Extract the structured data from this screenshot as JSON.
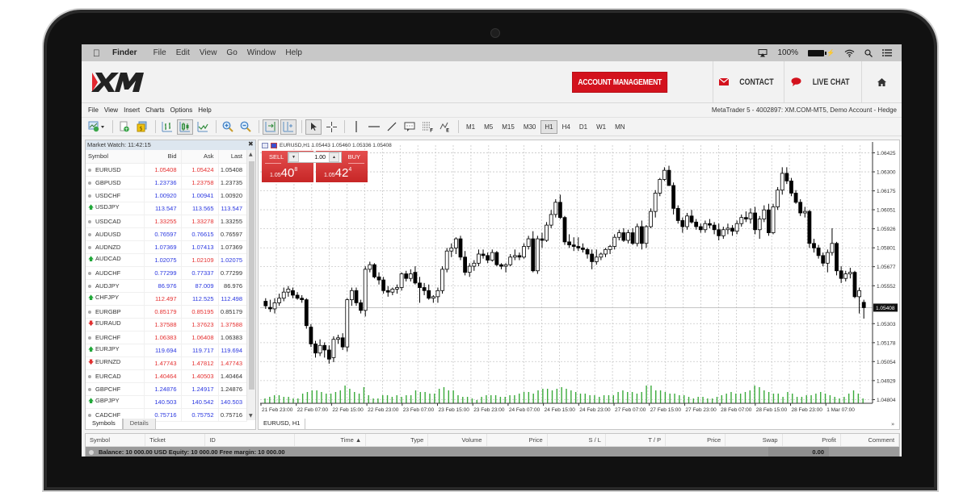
{
  "mac_menubar": {
    "apple_icon": "apple-logo-icon",
    "app": "Finder",
    "items": [
      "File",
      "Edit",
      "View",
      "Go",
      "Window",
      "Help"
    ],
    "status": {
      "airplay_icon": "airplay-icon",
      "battery_percent": "100%",
      "battery_icon": "battery-charging-icon",
      "wifi_icon": "wifi-icon",
      "search_icon": "spotlight-search-icon",
      "list_icon": "notification-list-icon"
    }
  },
  "header": {
    "logo": "XM",
    "account_management": "ACCOUNT MANAGEMENT",
    "contact": "CONTACT",
    "live_chat": "LIVE CHAT",
    "home_icon": "home-icon",
    "accent_color": "#d3121d"
  },
  "mt_menu": {
    "items": [
      "File",
      "View",
      "Insert",
      "Charts",
      "Options",
      "Help"
    ],
    "window_title": "MetaTrader 5 - 4002897: XM.COM-MT5, Demo Account - Hedge"
  },
  "toolbar": {
    "timeframes": [
      "M1",
      "M5",
      "M15",
      "M30",
      "H1",
      "H4",
      "D1",
      "W1",
      "MN"
    ],
    "active_timeframe": "H1"
  },
  "market_watch": {
    "title": "Market Watch: 11:42:15",
    "columns": [
      "Symbol",
      "Bid",
      "Ask",
      "Last"
    ],
    "rows": [
      {
        "symbol": "EURUSD",
        "indicator": "neutral",
        "bid": "1.05408",
        "bid_c": "red",
        "ask": "1.05424",
        "ask_c": "red",
        "last": "1.05408",
        "last_c": "blk"
      },
      {
        "symbol": "GBPUSD",
        "indicator": "neutral",
        "bid": "1.23736",
        "bid_c": "blue",
        "ask": "1.23758",
        "ask_c": "red",
        "last": "1.23735",
        "last_c": "blk"
      },
      {
        "symbol": "USDCHF",
        "indicator": "neutral",
        "bid": "1.00920",
        "bid_c": "blue",
        "ask": "1.00941",
        "ask_c": "blue",
        "last": "1.00920",
        "last_c": "blk"
      },
      {
        "symbol": "USDJPY",
        "indicator": "up",
        "bid": "113.547",
        "bid_c": "blue",
        "ask": "113.565",
        "ask_c": "blue",
        "last": "113.547",
        "last_c": "blue"
      },
      {
        "symbol": "USDCAD",
        "indicator": "neutral",
        "bid": "1.33255",
        "bid_c": "red",
        "ask": "1.33278",
        "ask_c": "red",
        "last": "1.33255",
        "last_c": "blk"
      },
      {
        "symbol": "AUDUSD",
        "indicator": "neutral",
        "bid": "0.76597",
        "bid_c": "blue",
        "ask": "0.76615",
        "ask_c": "blue",
        "last": "0.76597",
        "last_c": "blk"
      },
      {
        "symbol": "AUDNZD",
        "indicator": "neutral",
        "bid": "1.07369",
        "bid_c": "blue",
        "ask": "1.07413",
        "ask_c": "blue",
        "last": "1.07369",
        "last_c": "blk"
      },
      {
        "symbol": "AUDCAD",
        "indicator": "up",
        "bid": "1.02075",
        "bid_c": "blue",
        "ask": "1.02109",
        "ask_c": "red",
        "last": "1.02075",
        "last_c": "blue"
      },
      {
        "symbol": "AUDCHF",
        "indicator": "neutral",
        "bid": "0.77299",
        "bid_c": "blue",
        "ask": "0.77337",
        "ask_c": "blue",
        "last": "0.77299",
        "last_c": "blk"
      },
      {
        "symbol": "AUDJPY",
        "indicator": "neutral",
        "bid": "86.976",
        "bid_c": "blue",
        "ask": "87.009",
        "ask_c": "blue",
        "last": "86.976",
        "last_c": "blk"
      },
      {
        "symbol": "CHFJPY",
        "indicator": "up",
        "bid": "112.497",
        "bid_c": "red",
        "ask": "112.525",
        "ask_c": "blue",
        "last": "112.498",
        "last_c": "blue"
      },
      {
        "symbol": "EURGBP",
        "indicator": "neutral",
        "bid": "0.85179",
        "bid_c": "red",
        "ask": "0.85195",
        "ask_c": "red",
        "last": "0.85179",
        "last_c": "blk"
      },
      {
        "symbol": "EURAUD",
        "indicator": "down",
        "bid": "1.37588",
        "bid_c": "red",
        "ask": "1.37623",
        "ask_c": "red",
        "last": "1.37588",
        "last_c": "red"
      },
      {
        "symbol": "EURCHF",
        "indicator": "neutral",
        "bid": "1.06383",
        "bid_c": "red",
        "ask": "1.06408",
        "ask_c": "red",
        "last": "1.06383",
        "last_c": "blk"
      },
      {
        "symbol": "EURJPY",
        "indicator": "up",
        "bid": "119.694",
        "bid_c": "blue",
        "ask": "119.717",
        "ask_c": "blue",
        "last": "119.694",
        "last_c": "blue"
      },
      {
        "symbol": "EURNZD",
        "indicator": "down",
        "bid": "1.47743",
        "bid_c": "red",
        "ask": "1.47812",
        "ask_c": "red",
        "last": "1.47743",
        "last_c": "red"
      },
      {
        "symbol": "EURCAD",
        "indicator": "neutral",
        "bid": "1.40464",
        "bid_c": "red",
        "ask": "1.40503",
        "ask_c": "red",
        "last": "1.40464",
        "last_c": "blk"
      },
      {
        "symbol": "GBPCHF",
        "indicator": "neutral",
        "bid": "1.24876",
        "bid_c": "blue",
        "ask": "1.24917",
        "ask_c": "blue",
        "last": "1.24876",
        "last_c": "blk"
      },
      {
        "symbol": "GBPJPY",
        "indicator": "up",
        "bid": "140.503",
        "bid_c": "blue",
        "ask": "140.542",
        "ask_c": "blue",
        "last": "140.503",
        "last_c": "blue"
      },
      {
        "symbol": "CADCHF",
        "indicator": "neutral",
        "bid": "0.75716",
        "bid_c": "blue",
        "ask": "0.75752",
        "ask_c": "blue",
        "last": "0.75716",
        "last_c": "blk"
      }
    ],
    "tabs": [
      "Symbols",
      "Details"
    ],
    "active_tab": "Symbols",
    "colors": {
      "up": "#2a37e0",
      "down": "#e53030"
    }
  },
  "chart": {
    "header": "EURUSD,H1  1.05443 1.05460 1.05336 1.05408",
    "sell_label": "SELL",
    "buy_label": "BUY",
    "volume": "1.00",
    "sell_price": {
      "prefix": "1.05",
      "big": "40",
      "sup": "8"
    },
    "buy_price": {
      "prefix": "1.05",
      "big": "42",
      "sup": "4"
    },
    "tab": "EURUSD, H1",
    "price_labels": [
      "1.06425",
      "1.06300",
      "1.06175",
      "1.06051",
      "1.05926",
      "1.05801",
      "1.05677",
      "1.05552",
      "1.05303",
      "1.05178",
      "1.05054",
      "1.04929",
      "1.04804"
    ],
    "current_price": "1.05408",
    "time_labels": [
      "21 Feb 23:00",
      "22 Feb 07:00",
      "22 Feb 15:00",
      "22 Feb 23:00",
      "23 Feb 07:00",
      "23 Feb 15:00",
      "23 Feb 23:00",
      "24 Feb 07:00",
      "24 Feb 15:00",
      "24 Feb 23:00",
      "27 Feb 07:00",
      "27 Feb 15:00",
      "27 Feb 23:00",
      "28 Feb 07:00",
      "28 Feb 15:00",
      "28 Feb 23:00",
      "1 Mar 07:00"
    ],
    "candles": [
      [
        1.0545,
        1.0547,
        1.054,
        1.0542
      ],
      [
        1.0541,
        1.0546,
        1.0538,
        1.054
      ],
      [
        1.054,
        1.0547,
        1.0537,
        1.0544
      ],
      [
        1.0544,
        1.055,
        1.0542,
        1.0547
      ],
      [
        1.0547,
        1.0554,
        1.0545,
        1.0551
      ],
      [
        1.0551,
        1.0555,
        1.0548,
        1.0553
      ],
      [
        1.0552,
        1.0554,
        1.0547,
        1.0549
      ],
      [
        1.0549,
        1.0551,
        1.0546,
        1.0547
      ],
      [
        1.0547,
        1.0549,
        1.0544,
        1.0546
      ],
      [
        1.0546,
        1.0547,
        1.0527,
        1.0529
      ],
      [
        1.0528,
        1.053,
        1.0515,
        1.0517
      ],
      [
        1.0517,
        1.0519,
        1.0508,
        1.0511
      ],
      [
        1.0511,
        1.052,
        1.0509,
        1.0516
      ],
      [
        1.0516,
        1.0518,
        1.0508,
        1.0513
      ],
      [
        1.0513,
        1.0516,
        1.0504,
        1.0507
      ],
      [
        1.0508,
        1.0522,
        1.0505,
        1.052
      ],
      [
        1.052,
        1.0523,
        1.0517,
        1.0521
      ],
      [
        1.0521,
        1.0524,
        1.0513,
        1.0515
      ],
      [
        1.0515,
        1.0547,
        1.0512,
        1.0546
      ],
      [
        1.0546,
        1.0554,
        1.0542,
        1.0552
      ],
      [
        1.0552,
        1.0554,
        1.0542,
        1.0544
      ],
      [
        1.0544,
        1.0546,
        1.0537,
        1.0539
      ],
      [
        1.0539,
        1.0568,
        1.0535,
        1.0566
      ],
      [
        1.0566,
        1.0571,
        1.0564,
        1.0569
      ],
      [
        1.0569,
        1.057,
        1.056,
        1.0561
      ],
      [
        1.0561,
        1.0564,
        1.0556,
        1.0559
      ],
      [
        1.0559,
        1.0561,
        1.055,
        1.0552
      ],
      [
        1.0552,
        1.0555,
        1.0548,
        1.0551
      ],
      [
        1.0551,
        1.0554,
        1.0549,
        1.0553
      ],
      [
        1.0553,
        1.0556,
        1.055,
        1.0554
      ],
      [
        1.0554,
        1.0564,
        1.0552,
        1.0563
      ],
      [
        1.0563,
        1.0565,
        1.0558,
        1.056
      ],
      [
        1.056,
        1.0566,
        1.0558,
        1.0563
      ],
      [
        1.0564,
        1.0568,
        1.0556,
        1.0557
      ],
      [
        1.0557,
        1.0561,
        1.0544,
        1.0554
      ],
      [
        1.0554,
        1.0557,
        1.0549,
        1.0552
      ],
      [
        1.0552,
        1.0556,
        1.0546,
        1.0547
      ],
      [
        1.0547,
        1.0549,
        1.0544,
        1.0548
      ],
      [
        1.0548,
        1.0554,
        1.0544,
        1.0552
      ],
      [
        1.0552,
        1.0568,
        1.055,
        1.0566
      ],
      [
        1.0566,
        1.058,
        1.0564,
        1.0578
      ],
      [
        1.0578,
        1.0583,
        1.0574,
        1.058
      ],
      [
        1.058,
        1.0587,
        1.0576,
        1.0586
      ],
      [
        1.0586,
        1.0588,
        1.0572,
        1.0574
      ],
      [
        1.0574,
        1.0578,
        1.0562,
        1.0564
      ],
      [
        1.0564,
        1.057,
        1.0561,
        1.0568
      ],
      [
        1.0568,
        1.0572,
        1.0565,
        1.057
      ],
      [
        1.057,
        1.0579,
        1.0568,
        1.0576
      ],
      [
        1.0576,
        1.0579,
        1.0573,
        1.0575
      ],
      [
        1.0575,
        1.0577,
        1.057,
        1.0572
      ],
      [
        1.0572,
        1.0579,
        1.0571,
        1.0577
      ],
      [
        1.0577,
        1.0578,
        1.0568,
        1.0569
      ],
      [
        1.0569,
        1.057,
        1.0566,
        1.0568
      ],
      [
        1.0568,
        1.057,
        1.0564,
        1.0569
      ],
      [
        1.0569,
        1.0576,
        1.0568,
        1.0574
      ],
      [
        1.0574,
        1.0579,
        1.0572,
        1.0575
      ],
      [
        1.0575,
        1.0577,
        1.0572,
        1.0574
      ],
      [
        1.0574,
        1.0583,
        1.0573,
        1.0581
      ],
      [
        1.0581,
        1.0588,
        1.0579,
        1.0586
      ],
      [
        1.0586,
        1.0591,
        1.0564,
        1.0565
      ],
      [
        1.0565,
        1.0588,
        1.0563,
        1.0586
      ],
      [
        1.0586,
        1.059,
        1.058,
        1.0585
      ],
      [
        1.0585,
        1.0597,
        1.0584,
        1.0595
      ],
      [
        1.0595,
        1.0605,
        1.0593,
        1.0602
      ],
      [
        1.0602,
        1.0612,
        1.06,
        1.061
      ],
      [
        1.061,
        1.0615,
        1.0599,
        1.06
      ],
      [
        1.06,
        1.0601,
        1.0582,
        1.0584
      ],
      [
        1.0584,
        1.0589,
        1.058,
        1.0582
      ],
      [
        1.0582,
        1.0587,
        1.0578,
        1.0581
      ],
      [
        1.0581,
        1.0587,
        1.0578,
        1.058
      ],
      [
        1.058,
        1.0583,
        1.0577,
        1.0579
      ],
      [
        1.0579,
        1.058,
        1.0573,
        1.0576
      ],
      [
        1.0576,
        1.0579,
        1.0566,
        1.0571
      ],
      [
        1.0571,
        1.0579,
        1.0569,
        1.0574
      ],
      [
        1.0574,
        1.0577,
        1.0572,
        1.0576
      ],
      [
        1.0576,
        1.058,
        1.0574,
        1.0579
      ],
      [
        1.0579,
        1.0582,
        1.0576,
        1.0581
      ],
      [
        1.0581,
        1.0589,
        1.0579,
        1.0587
      ],
      [
        1.0587,
        1.0592,
        1.0585,
        1.059
      ],
      [
        1.059,
        1.0593,
        1.0584,
        1.0585
      ],
      [
        1.0585,
        1.0592,
        1.0583,
        1.059
      ],
      [
        1.059,
        1.0593,
        1.0582,
        1.0583
      ],
      [
        1.0583,
        1.0596,
        1.0581,
        1.0594
      ],
      [
        1.0594,
        1.0598,
        1.0579,
        1.0583
      ],
      [
        1.0583,
        1.0595,
        1.058,
        1.0594
      ],
      [
        1.0594,
        1.0606,
        1.0593,
        1.0604
      ],
      [
        1.0604,
        1.0618,
        1.06,
        1.0616
      ],
      [
        1.0616,
        1.0626,
        1.0614,
        1.0625
      ],
      [
        1.0625,
        1.0633,
        1.0624,
        1.0631
      ],
      [
        1.0631,
        1.0634,
        1.0621,
        1.0621
      ],
      [
        1.0621,
        1.0623,
        1.0602,
        1.0606
      ],
      [
        1.0606,
        1.0608,
        1.0596,
        1.0598
      ],
      [
        1.0598,
        1.06,
        1.059,
        1.0594
      ],
      [
        1.0594,
        1.0603,
        1.0592,
        1.0601
      ],
      [
        1.0601,
        1.0605,
        1.0596,
        1.0597
      ],
      [
        1.0597,
        1.0599,
        1.0592,
        1.0594
      ],
      [
        1.0594,
        1.0596,
        1.059,
        1.0592
      ],
      [
        1.0592,
        1.0598,
        1.059,
        1.0596
      ],
      [
        1.0596,
        1.0599,
        1.0593,
        1.0595
      ],
      [
        1.0595,
        1.0597,
        1.0589,
        1.0592
      ],
      [
        1.0592,
        1.0596,
        1.0585,
        1.0588
      ],
      [
        1.0588,
        1.0594,
        1.0586,
        1.0592
      ],
      [
        1.0592,
        1.0596,
        1.0589,
        1.0593
      ],
      [
        1.0593,
        1.0595,
        1.0588,
        1.0591
      ],
      [
        1.0591,
        1.0598,
        1.0589,
        1.0596
      ],
      [
        1.0596,
        1.0602,
        1.0594,
        1.06
      ],
      [
        1.06,
        1.0604,
        1.0597,
        1.0599
      ],
      [
        1.0599,
        1.0606,
        1.0596,
        1.0603
      ],
      [
        1.0603,
        1.0607,
        1.0589,
        1.0592
      ],
      [
        1.0592,
        1.0601,
        1.0586,
        1.0599
      ],
      [
        1.0599,
        1.0608,
        1.0597,
        1.0605
      ],
      [
        1.0605,
        1.0609,
        1.0588,
        1.059
      ],
      [
        1.059,
        1.0609,
        1.0589,
        1.0607
      ],
      [
        1.0607,
        1.062,
        1.0605,
        1.0618
      ],
      [
        1.0618,
        1.0633,
        1.0615,
        1.0629
      ],
      [
        1.0629,
        1.0633,
        1.0622,
        1.0624
      ],
      [
        1.0624,
        1.0626,
        1.0614,
        1.0616
      ],
      [
        1.0616,
        1.0618,
        1.0609,
        1.061
      ],
      [
        1.061,
        1.0612,
        1.0601,
        1.0603
      ],
      [
        1.0603,
        1.0607,
        1.06,
        1.0604
      ],
      [
        1.0604,
        1.0605,
        1.058,
        1.0583
      ],
      [
        1.0583,
        1.0586,
        1.0577,
        1.058
      ],
      [
        1.058,
        1.0582,
        1.0573,
        1.0575
      ],
      [
        1.0575,
        1.0577,
        1.0568,
        1.057
      ],
      [
        1.057,
        1.0579,
        1.0564,
        1.0577
      ],
      [
        1.0577,
        1.0593,
        1.0575,
        1.0583
      ],
      [
        1.0583,
        1.0584,
        1.0562,
        1.0565
      ],
      [
        1.0565,
        1.0568,
        1.0557,
        1.056
      ],
      [
        1.056,
        1.0565,
        1.0558,
        1.0563
      ],
      [
        1.0563,
        1.0567,
        1.056,
        1.0564
      ],
      [
        1.0564,
        1.0565,
        1.0547,
        1.0548
      ],
      [
        1.0548,
        1.0554,
        1.0537,
        1.0552
      ],
      [
        1.05443,
        1.0546,
        1.05336,
        1.05408
      ]
    ],
    "volumes": [
      3,
      4,
      5,
      5,
      4,
      4,
      3,
      3,
      6,
      7,
      8,
      8,
      7,
      6,
      6,
      7,
      8,
      11,
      9,
      7,
      6,
      10,
      5,
      3,
      3,
      5,
      5,
      4,
      5,
      4,
      5,
      5,
      8,
      7,
      7,
      6,
      6,
      9,
      10,
      8,
      8,
      5,
      4,
      4,
      3,
      2,
      4,
      5,
      5,
      5,
      4,
      4,
      5,
      5,
      6,
      7,
      7,
      6,
      8,
      9,
      9,
      8,
      9,
      10,
      9,
      8,
      7,
      6,
      6,
      5,
      5,
      4,
      5,
      5,
      5,
      7,
      8,
      7,
      7,
      6,
      7,
      11,
      11,
      8,
      8,
      7,
      6,
      6,
      5,
      5,
      4,
      3,
      4,
      4,
      3,
      3,
      4,
      5,
      6,
      7,
      6,
      6,
      7,
      8,
      11,
      10,
      8,
      7,
      6,
      6,
      4,
      7,
      6,
      4,
      4,
      5,
      5,
      6,
      7,
      6,
      5,
      4,
      3,
      4,
      6,
      8,
      6,
      3
    ]
  },
  "toolbox": {
    "columns": [
      "Symbol",
      "Ticket",
      "ID",
      "Time ▲",
      "Type",
      "Volume",
      "Price",
      "S / L",
      "T / P",
      "Price",
      "Swap",
      "Profit",
      "Comment"
    ],
    "balance_line": "Balance: 10 000.00 USD  Equity: 10 000.00  Free margin: 10 000.00",
    "profit": "0.00"
  }
}
